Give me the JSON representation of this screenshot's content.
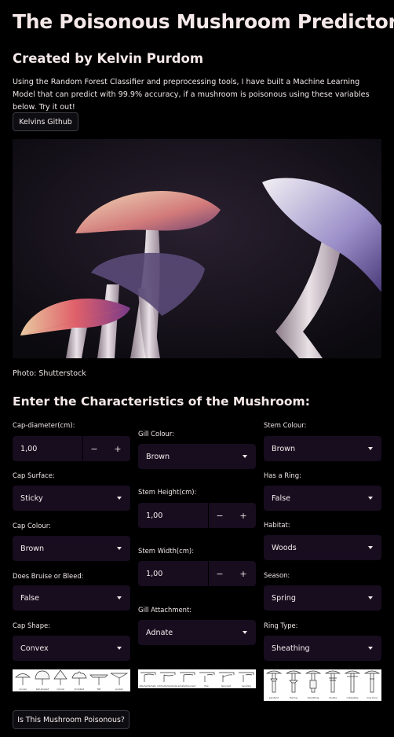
{
  "title": "The Poisonous Mushroom Predictor",
  "subtitle": "Created by Kelvin Purdom",
  "intro": "Using the Random Forest Classifier and preprocessing tools, I have built a Machine Learning Model that can predict with 99.9% accuracy, if a mushroom is poisonous using these variables below. Try it out!",
  "github_button": "Kelvins Github",
  "photo_caption": "Photo: Shutterstock",
  "form_heading": "Enter the Characteristics of the Mushroom:",
  "fields": {
    "cap_diameter": {
      "label": "Cap-diameter(cm):",
      "value": "1,00",
      "minus": "−",
      "plus": "+"
    },
    "cap_surface": {
      "label": "Cap Surface:",
      "value": "Sticky"
    },
    "cap_colour": {
      "label": "Cap Colour:",
      "value": "Brown"
    },
    "bruise_bleed": {
      "label": "Does Bruise or Bleed:",
      "value": "False"
    },
    "cap_shape": {
      "label": "Cap Shape:",
      "value": "Convex"
    },
    "gill_colour": {
      "label": "Gill Colour:",
      "value": "Brown"
    },
    "stem_height": {
      "label": "Stem Height(cm):",
      "value": "1,00",
      "minus": "−",
      "plus": "+"
    },
    "stem_width": {
      "label": "Stem Width(cm):",
      "value": "1,00",
      "minus": "−",
      "plus": "+"
    },
    "gill_attachment": {
      "label": "Gill Attachment:",
      "value": "Adnate"
    },
    "stem_colour": {
      "label": "Stem Colour:",
      "value": "Brown"
    },
    "has_ring": {
      "label": "Has a Ring:",
      "value": "False"
    },
    "habitat": {
      "label": "Habitat:",
      "value": "Woods"
    },
    "season": {
      "label": "Season:",
      "value": "Spring"
    },
    "ring_type": {
      "label": "Ring Type:",
      "value": "Sheathing"
    }
  },
  "reference_images": {
    "cap_shape": [
      "convex",
      "bell-shaped",
      "conical",
      "knobbed",
      "flat",
      "sunken"
    ],
    "gill_attachment": [
      "attached/adnate",
      "notched/emarginate",
      "adnate/decurrent",
      "free",
      "decurrent",
      "seceding"
    ],
    "ring_type": [
      "pendant",
      "flaring",
      "sheathing",
      "double",
      "cobwebby",
      "ring zone"
    ]
  },
  "submit_button": "Is This Mushroom Poisonous?",
  "colors": {
    "background": "#000000",
    "input_bg": "#170d1f",
    "button_border": "#3e3c45",
    "text": "#f4ecec"
  }
}
